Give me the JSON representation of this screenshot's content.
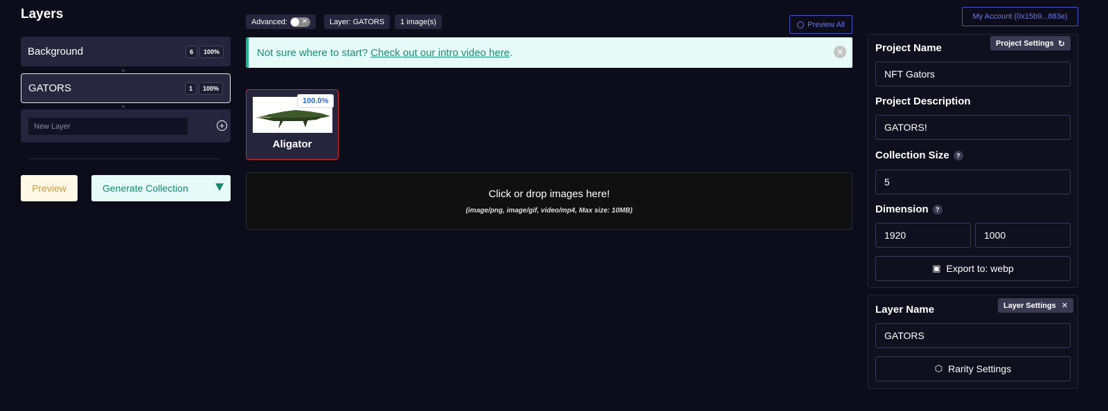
{
  "layers": {
    "title": "Layers",
    "items": [
      {
        "name": "Background",
        "count": "6",
        "percent": "100%"
      },
      {
        "name": "GATORS",
        "count": "1",
        "percent": "100%"
      }
    ],
    "new_layer_placeholder": "New Layer",
    "preview_label": "Preview",
    "generate_label": "Generate Collection"
  },
  "toolbar": {
    "advanced_label": "Advanced:",
    "toggle_state_glyph": "✕",
    "layer_chip": "Layer: GATORS",
    "images_chip": "1 image(s)",
    "preview_all": "Preview All"
  },
  "banner": {
    "text": "Not sure where to start?",
    "link_text": "Check out our intro video here",
    "suffix": "."
  },
  "images": [
    {
      "name": "Aligator",
      "percent": "100.0%"
    }
  ],
  "dropzone": {
    "title": "Click or drop images here!",
    "subtitle": "(image/png, image/gif, video/mp4, Max size: 10MB)"
  },
  "account": {
    "label": "My Account (0x15b9...883e)"
  },
  "project": {
    "settings_chip": "Project Settings",
    "name_label": "Project Name",
    "name_value": "NFT Gators",
    "desc_label": "Project Description",
    "desc_value": "GATORS!",
    "size_label": "Collection Size",
    "size_value": "5",
    "dim_label": "Dimension",
    "dim_width": "1920",
    "dim_height": "1000",
    "export_label": "Export to: webp"
  },
  "layer_settings": {
    "chip": "Layer Settings",
    "name_label": "Layer Name",
    "name_value": "GATORS",
    "rarity_label": "Rarity Settings"
  }
}
